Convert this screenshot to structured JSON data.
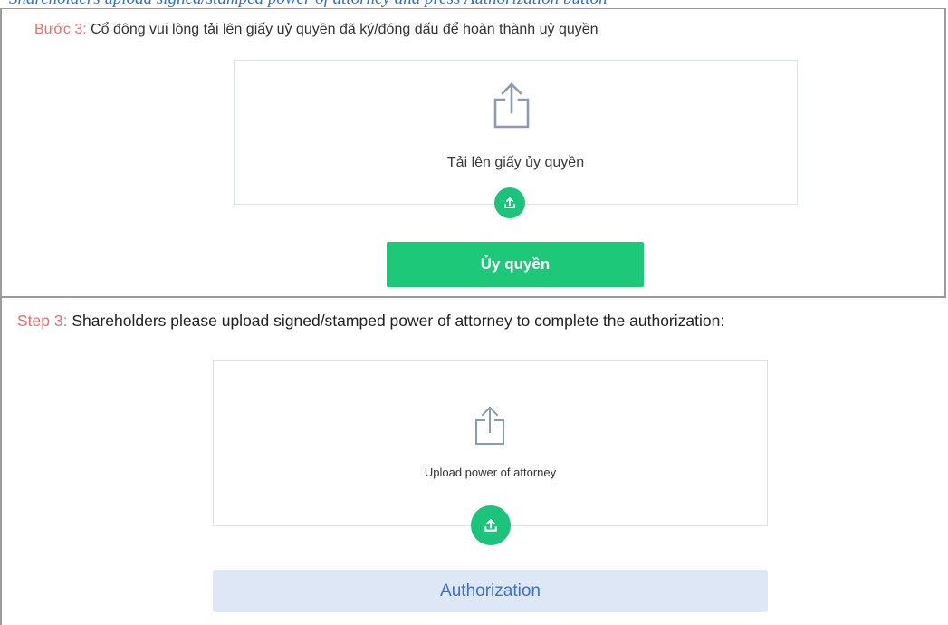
{
  "top_caption": {
    "text": "Shareholders upload signed/stamped power of attorney and press Authorization button"
  },
  "vietnamese_panel": {
    "step_prefix": "Bước 3:",
    "step_text": " Cổ đông vui lòng tải lên giấy uỷ quyền đã ký/đóng dấu để hoàn thành uỷ quyền",
    "dropzone_label": "Tải lên giấy ủy quyền",
    "upload_icon": "share-upload-icon",
    "fab_icon": "upload-tray-icon",
    "submit_label": "Ủy quyền"
  },
  "english_panel": {
    "step_prefix": "Step 3:",
    "step_text": " Shareholders please upload signed/stamped power of attorney to complete the authorization:",
    "dropzone_label": "Upload power of attorney",
    "upload_icon": "share-upload-icon",
    "fab_icon": "upload-tray-icon",
    "submit_label": "Authorization"
  },
  "colors": {
    "step_prefix": "#f06b6b",
    "primary_green": "#1dc878",
    "icon_gray_blue": "#8a9bb5",
    "english_button_bg": "#dde7f5",
    "english_button_text": "#3b6fd8",
    "caption_blue": "#2f6fd6"
  }
}
